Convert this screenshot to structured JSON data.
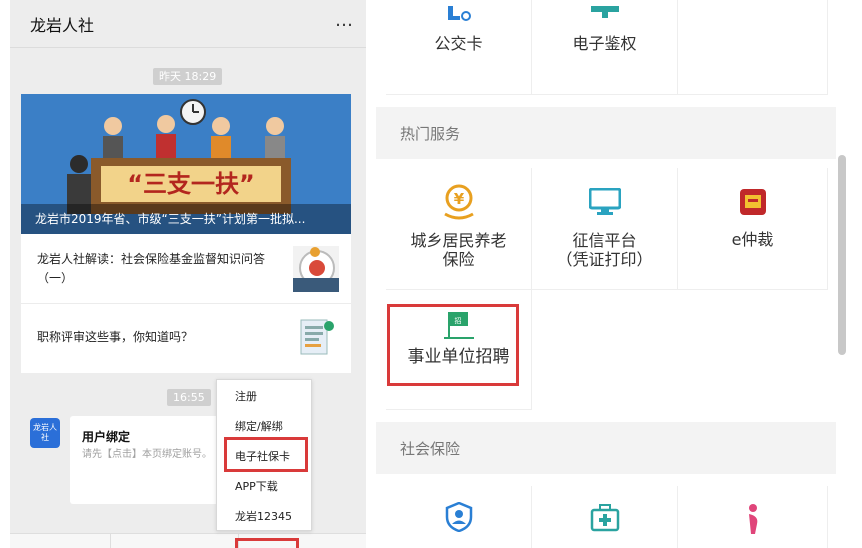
{
  "chat": {
    "title": "龙岩人社",
    "more_icon": "…",
    "time1": "昨天 18:29",
    "time2": "16:55",
    "hero_caption": "龙岩市2019年省、市级“三支一扶”计划第一批拟...",
    "hero_banner_text": "“三支一扶”",
    "articles": [
      {
        "title": "龙岩人社解读：社会保险基金监督知识问答（一）"
      },
      {
        "title": "职称评审这些事，你知道吗？"
      }
    ],
    "avatar_text": "龙岩人社",
    "bind_card": {
      "title": "用户绑定",
      "desc": "请先【点击】本页绑定账号。"
    },
    "popup_menu": [
      "注册",
      "绑定/解绑",
      "电子社保卡",
      "APP下载",
      "龙岩12345"
    ]
  },
  "services": {
    "top_row": [
      {
        "label": "公交卡",
        "icon": "card-icon"
      },
      {
        "label": "电子鉴权",
        "icon": "monitor-icon"
      }
    ],
    "hot_section": "热门服务",
    "hot_items": [
      {
        "label": "城乡居民养老保险",
        "line1": "城乡居民养老",
        "line2": "保险",
        "icon": "yuan-coin-icon"
      },
      {
        "label": "征信平台（凭证打印）",
        "line1": "征信平台",
        "line2": "（凭证打印）",
        "icon": "monitor-icon"
      },
      {
        "label": "e仲裁",
        "icon": "badge-icon"
      },
      {
        "label": "事业单位招聘",
        "icon": "flag-icon"
      }
    ],
    "social_section": "社会保险",
    "social_icons": [
      "shield-person-icon",
      "medical-kit-icon",
      "pregnant-icon"
    ]
  },
  "colors": {
    "highlight": "#d93a3a",
    "accent_green": "#2aa36b",
    "brand_blue": "#2b6fd8"
  }
}
